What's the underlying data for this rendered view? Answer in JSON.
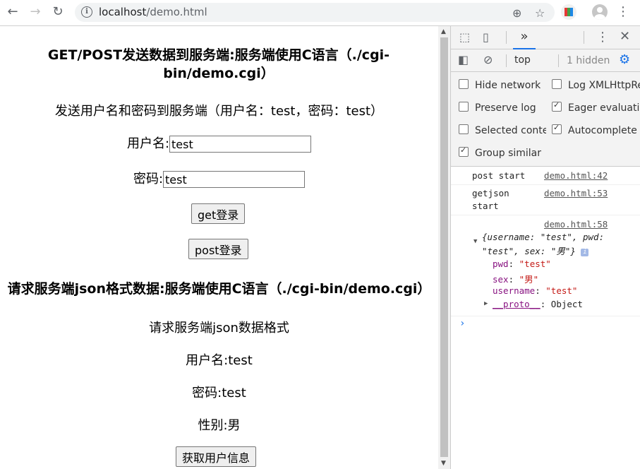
{
  "browser": {
    "url_host": "localhost",
    "url_path": "/demo.html"
  },
  "page": {
    "section1_title": "GET/POST发送数据到服务端:服务端使用C语言（./cgi-bin/demo.cgi）",
    "section1_desc": "发送用户名和密码到服务端（用户名：test，密码：test）",
    "username_label": "用户名:",
    "username_value": "test",
    "password_label": "密码:",
    "password_value": "test",
    "get_button": "get登录",
    "post_button": "post登录",
    "section2_title": "请求服务端json格式数据:服务端使用C语言（./cgi-bin/demo.cgi）",
    "section2_desc": "请求服务端json数据格式",
    "result_username": "用户名:test",
    "result_password": "密码:test",
    "result_sex": "性别:男",
    "fetch_button": "获取用户信息"
  },
  "devtools": {
    "context": "top",
    "hidden_count": "1 hidden",
    "options": {
      "hide_network": "Hide network",
      "log_xhr": "Log XMLHttpRequests",
      "preserve_log": "Preserve log",
      "eager_eval": "Eager evaluation",
      "selected_context": "Selected context only",
      "autocomplete": "Autocomplete from history",
      "group_similar": "Group similar"
    },
    "option_states": {
      "hide_network": false,
      "log_xhr": false,
      "preserve_log": false,
      "eager_eval": true,
      "selected_context": false,
      "autocomplete": true,
      "group_similar": true
    },
    "console": {
      "msg1_text": "post start",
      "msg1_src": "demo.html:42",
      "msg2_text": "getjson",
      "msg2_text2": "start",
      "msg2_src": "demo.html:53",
      "msg3_src": "demo.html:58",
      "obj_summary_1": "{username: \"test\", pwd:",
      "obj_summary_2": "\"test\", sex: \"男\"}",
      "prop_pwd_key": "pwd",
      "prop_pwd_val": "\"test\"",
      "prop_sex_key": "sex",
      "prop_sex_val": "\"男\"",
      "prop_username_key": "username",
      "prop_username_val": "\"test\"",
      "proto_key": "__proto__",
      "proto_val": "Object"
    }
  }
}
